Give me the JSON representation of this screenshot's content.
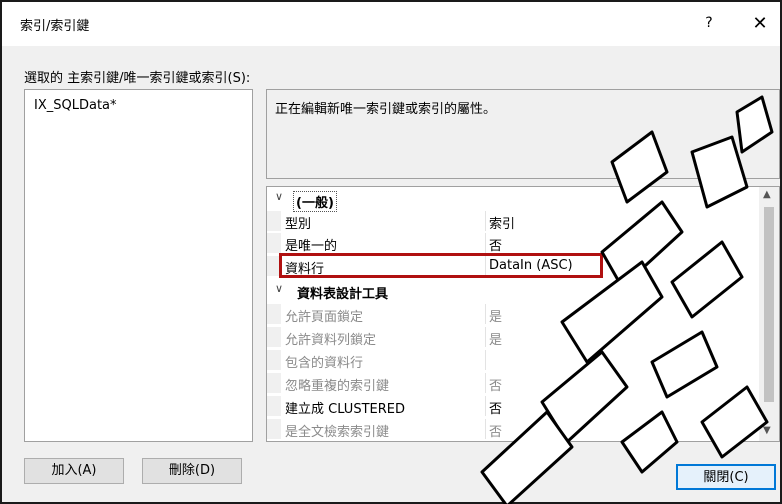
{
  "window": {
    "title": "索引/索引鍵",
    "help_label": "?",
    "close_label": "✕"
  },
  "index_list": {
    "label": "選取的 主索引鍵/唯一索引鍵或索引(S):",
    "items": [
      "IX_SQLData*"
    ]
  },
  "description": "正在編輯新唯一索引鍵或索引的屬性。",
  "properties": {
    "category_general": "(一般)",
    "general_rows": [
      {
        "name": "型別",
        "value": "索引"
      },
      {
        "name": "是唯一的",
        "value": "否"
      },
      {
        "name": "資料行",
        "value": "DataIn (ASC)"
      }
    ],
    "category_designer": "資料表設計工具",
    "designer_rows": [
      {
        "name": "允許頁面鎖定",
        "value": "是"
      },
      {
        "name": "允許資料列鎖定",
        "value": "是"
      },
      {
        "name": "包含的資料行",
        "value": ""
      },
      {
        "name": "忽略重複的索引鍵",
        "value": "否"
      },
      {
        "name": "建立成 CLUSTERED",
        "value": "否"
      },
      {
        "name": "是全文檢索索引鍵",
        "value": "否"
      }
    ]
  },
  "buttons": {
    "add": "加入(A)",
    "delete": "刪除(D)",
    "close": "關閉(C)"
  },
  "icons": {
    "expander": "chevron-down-icon",
    "scroll_up": "scroll-up-arrow-icon",
    "scroll_down": "scroll-down-arrow-icon"
  },
  "colors": {
    "highlight_border": "#b01010",
    "focus_border": "#0078d7"
  }
}
